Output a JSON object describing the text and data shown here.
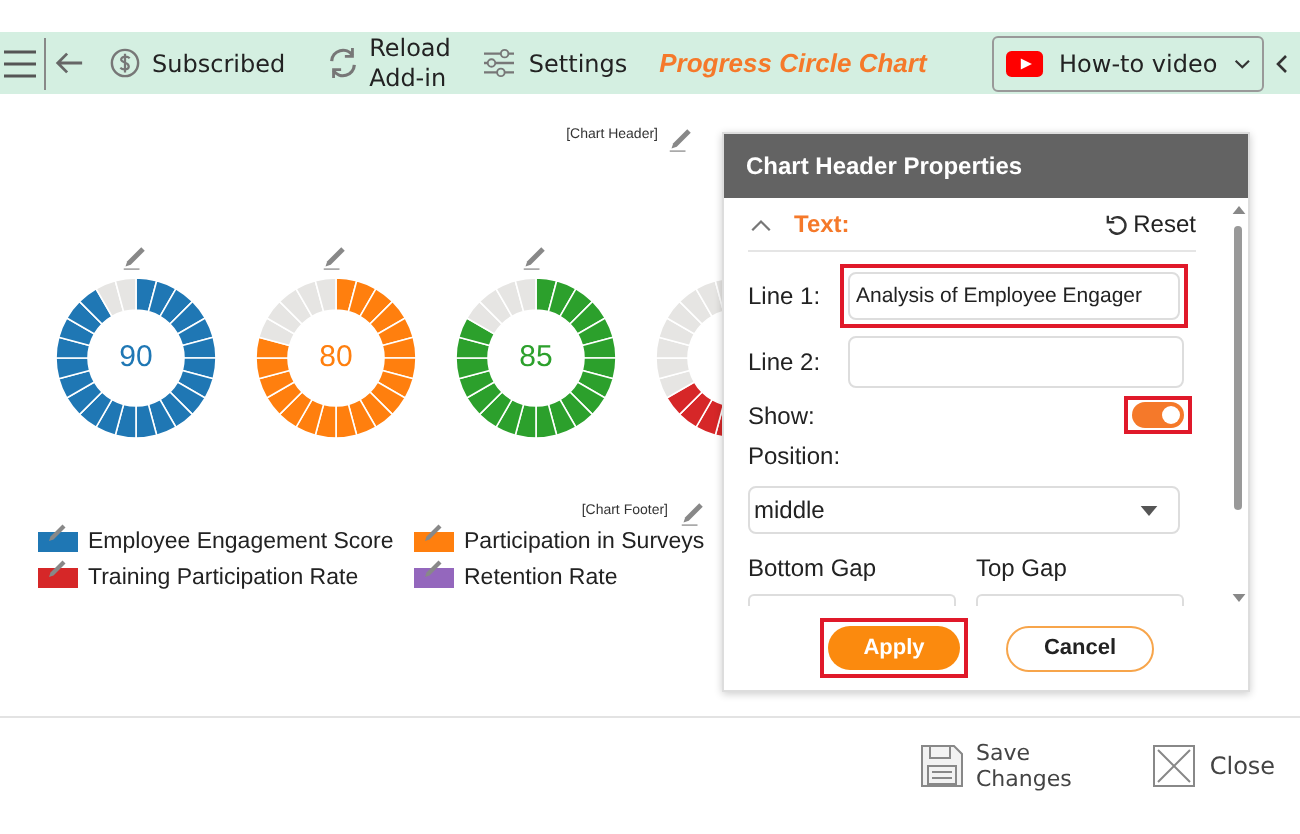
{
  "toolbar": {
    "subscribed": "Subscribed",
    "reload": "Reload\nAdd-in",
    "settings": "Settings",
    "title": "Progress Circle Chart",
    "video": "How-to video"
  },
  "chart": {
    "header_label": "[Chart Header]",
    "footer_label": "[Chart Footer]",
    "rings": [
      {
        "value": "90",
        "level": 0.9,
        "color": "#1f77b4"
      },
      {
        "value": "80",
        "level": 0.8,
        "color": "#ff7f0e"
      },
      {
        "value": "85",
        "level": 0.85,
        "color": "#2ca02c"
      },
      {
        "level": 0.67,
        "color": "#d62728"
      }
    ],
    "legend": [
      {
        "label": "Employee Engagement Score",
        "color": "#1f77b4"
      },
      {
        "label": "Participation in Surveys",
        "color": "#ff7f0e"
      },
      {
        "label": "Training Participation Rate",
        "color": "#d62728"
      },
      {
        "label": "Retention Rate",
        "color": "#9467bd"
      }
    ]
  },
  "panel": {
    "title": "Chart Header Properties",
    "section": "Text:",
    "expanded": true,
    "reset": "Reset",
    "line1_label": "Line 1:",
    "line1": "Analysis of Employee Engager",
    "line2_label": "Line 2:",
    "show_label": "Show:",
    "show": true,
    "position_label": "Position:",
    "position": "middle",
    "bottom_gap_label": "Bottom Gap",
    "top_gap_label": "Top Gap",
    "apply": "Apply",
    "cancel": "Cancel"
  },
  "footer": {
    "save": "Save\nChanges",
    "close": "Close"
  }
}
